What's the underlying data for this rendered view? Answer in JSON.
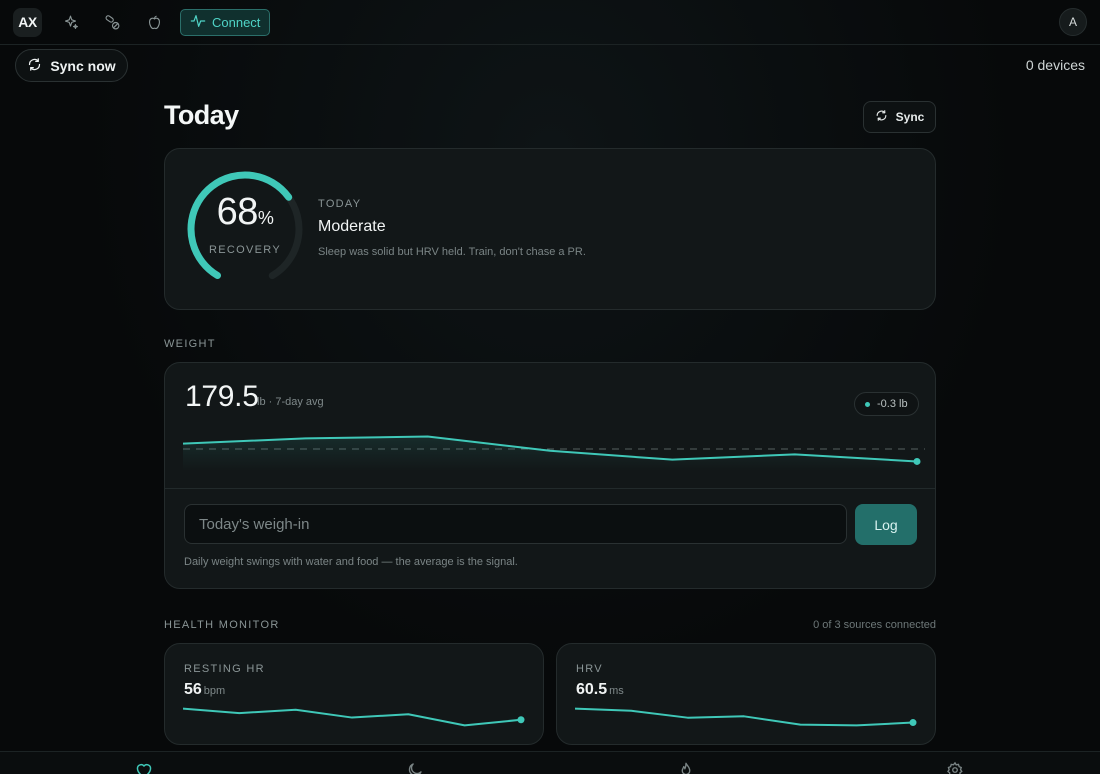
{
  "topbar": {
    "logo": "AX",
    "icons": [
      "sparkles-icon",
      "pills-icon",
      "apple-icon"
    ],
    "connect_label": "Connect",
    "avatar_initial": "A"
  },
  "subbar": {
    "sync_now_label": "Sync now",
    "devices_label": "0 devices"
  },
  "page": {
    "title": "Today",
    "sync_label": "Sync"
  },
  "recovery": {
    "value": "68",
    "unit": "%",
    "fraction": 0.68,
    "label": "RECOVERY",
    "kicker": "TODAY",
    "status": "Moderate",
    "note": "Sleep was solid but HRV held. Train, don't chase a PR."
  },
  "weight": {
    "section_label": "WEIGHT",
    "value": "179.5",
    "unit_label": "lb · 7-day avg",
    "delta": "-0.3 lb",
    "input_placeholder": "Today's weigh-in",
    "log_label": "Log",
    "note": "Daily weight swings with water and food — the average is the signal.",
    "series": [
      179.8,
      180.1,
      180.2,
      179.4,
      178.9,
      179.2,
      178.8
    ],
    "avg": 179.5
  },
  "health": {
    "section_label": "HEALTH MONITOR",
    "sources_label": "0 of 3 sources connected",
    "metrics": [
      {
        "label": "RESTING HR",
        "value": "56",
        "unit": "bpm",
        "series": [
          57.6,
          57.2,
          57.5,
          56.8,
          57.1,
          56.1,
          56.6
        ]
      },
      {
        "label": "HRV",
        "value": "60.5",
        "unit": "ms",
        "series": [
          62.5,
          62.2,
          61.2,
          61.4,
          60.2,
          60.1,
          60.5
        ]
      }
    ]
  },
  "tabs": [
    "heart-icon",
    "moon-icon",
    "flame-icon",
    "gear-icon"
  ],
  "colors": {
    "accent": "#3fc8b8",
    "background": "#07090a",
    "card": "#121718"
  }
}
